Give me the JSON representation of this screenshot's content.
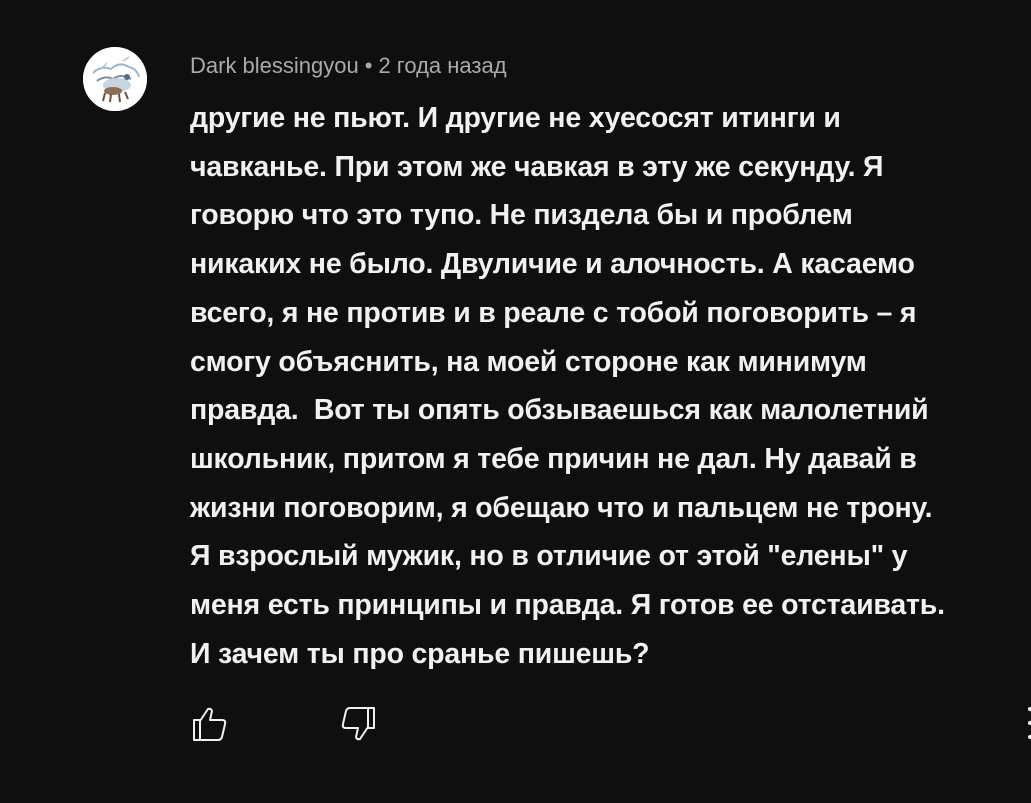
{
  "comment": {
    "author": "Dark blessingyou",
    "separator": "•",
    "timestamp": "2 года назад",
    "text_lines": [
      "другие не пьют. И другие не хуесосят итинги и",
      "чавканье. При этом же чавкая в эту же секунду. Я",
      "говорю что это тупо. Не пиздела бы и проблем",
      "никаких не было. Двуличие и алочность. А касаемо",
      "всего, я не против и в реале с тобой поговорить – я",
      "смогу объяснить, на моей стороне как минимум",
      "правда.  Вот ты опять обзываешься как малолетний",
      "школьник, притом я тебе причин не дал. Ну давай в",
      "жизни поговорим, я обещаю что и пальцем не трону.",
      "Я взрослый мужик, но в отличие от этой \"елены\" у",
      "меня есть принципы и правда. Я готов ее отстаивать.",
      "И зачем ты про сранье пишешь?"
    ]
  },
  "actions": {
    "like_icon": "thumbs-up-icon",
    "dislike_icon": "thumbs-down-icon",
    "more_icon": "more-vertical-icon"
  },
  "colors": {
    "background": "#0f0f0f",
    "text": "#f1f1f1",
    "secondary_text": "#aaaaaa"
  }
}
